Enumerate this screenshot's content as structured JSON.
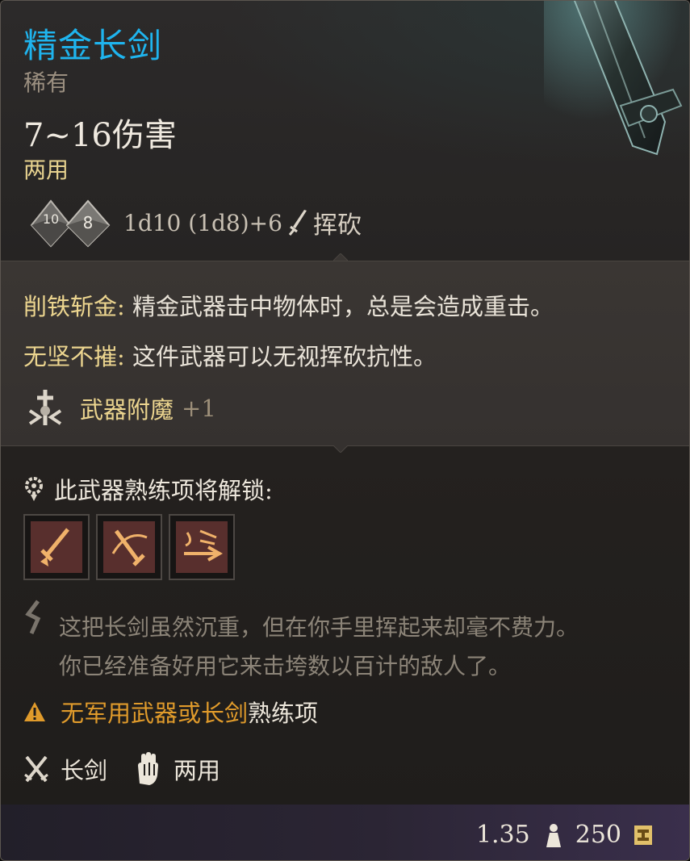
{
  "item": {
    "name": "精金长剑",
    "rarity": "稀有",
    "damage": "7~16伤害",
    "handedness": "两用",
    "dice": {
      "die1": "10",
      "die2": "8"
    },
    "damage_dice": "1d10 (1d8)+6",
    "damage_type": "挥砍"
  },
  "properties": [
    {
      "name": "削铁斩金:",
      "desc": " 精金武器击中物体时，总是会造成重击。"
    },
    {
      "name": "无坚不摧:",
      "desc": " 这件武器可以无视挥砍抗性。"
    }
  ],
  "enchantment": {
    "label": "武器附魔",
    "bonus": "+1"
  },
  "proficiency": {
    "label": "此武器熟练项将解锁:",
    "actions": [
      "pommel-strike",
      "flourish",
      "lacerate"
    ]
  },
  "flavor": {
    "line1": "这把长剑虽然沉重，但在你手里挥起来却毫不费力。",
    "line2": "你已经准备好用它来击垮数以百计的敌人了。"
  },
  "warning": {
    "highlight": "无军用武器或长剑",
    "rest": "熟练项"
  },
  "type_row": {
    "weapon_type": "长剑",
    "handedness": "两用"
  },
  "footer": {
    "weight": "1.35",
    "price": "250"
  },
  "colors": {
    "title": "#1fb4ee",
    "highlight": "#ecd58f",
    "warning": "#e09b2b",
    "flavor": "#8c8478"
  },
  "icons": [
    "dice-icon",
    "sword-swing-icon",
    "enchant-icon",
    "proficiency-gear-icon",
    "pommel-strike-icon",
    "flourish-icon",
    "lacerate-icon",
    "lore-icon",
    "warning-icon",
    "crossed-swords-icon",
    "two-hand-icon",
    "weight-icon",
    "gold-coin-icon"
  ]
}
